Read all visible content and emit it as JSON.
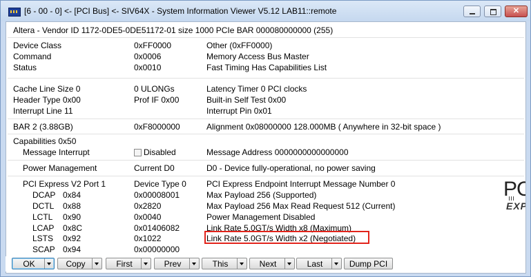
{
  "window": {
    "title": "[6 - 00 - 0] <- [PCI Bus] <- SIV64X - System Information Viewer V5.12 LAB11::remote"
  },
  "header": {
    "device_line": "Altera  - Vendor ID 1172-0DE5-0DE51172-01  size 1000  PCIe BAR 000080000000 (255)"
  },
  "rows": {
    "device_class": [
      "Device Class",
      "0xFF0000",
      "Other (0xFF0000)"
    ],
    "command": [
      "Command",
      "0x0006",
      "Memory Access  Bus Master"
    ],
    "status": [
      "Status",
      "0x0010",
      "Fast Timing  Has Capabilities List"
    ],
    "cache_line": [
      "Cache Line Size 0",
      "0 ULONGs",
      "Latency Timer 0 PCI clocks"
    ],
    "header_type": [
      "Header Type 0x00",
      "Prof IF 0x00",
      "Built-in Self Test 0x00"
    ],
    "interrupt_line": [
      "Interrupt Line 11",
      "",
      "Interrupt Pin  0x01"
    ],
    "bar2": [
      "BAR 2 (3.88GB)",
      "0xF8000000",
      "Alignment 0x08000000       128.000MB  ( Anywhere in 32-bit space )"
    ],
    "capabilities": "Capabilities 0x50",
    "msg_interrupt": [
      "Message Interrupt",
      "Disabled",
      "Message Address 0000000000000000"
    ],
    "power_mgmt": [
      "Power Management",
      "Current D0",
      "D0 - Device fully-operational, no power saving"
    ],
    "pcie_port": [
      "PCI Express V2 Port 1",
      "Device Type 0",
      "PCI Express Endpoint  Interrupt Message Number 0"
    ],
    "dcap": [
      "DCAP",
      "0x84",
      "0x00008001",
      "Max Payload 256 (Supported)"
    ],
    "dctl": [
      "DCTL",
      "0x88",
      "0x2820",
      "Max Payload 256  Max Read Request 512 (Current)"
    ],
    "lctl": [
      "LCTL",
      "0x90",
      "0x0040",
      "Power Management Disabled"
    ],
    "lcap": [
      "LCAP",
      "0x8C",
      "0x01406082",
      "Link Rate 5.0GT/s  Width x8  (Maximum)"
    ],
    "lsts": [
      "LSTS",
      "0x92",
      "0x1022",
      "Link Rate 5.0GT/s  Width x2  (Negotiated)"
    ],
    "scap": [
      "SCAP",
      "0x94",
      "0x00000000",
      ""
    ]
  },
  "logo": {
    "line1": "PC",
    "line2": "EXP"
  },
  "buttons": {
    "ok": "OK",
    "copy": "Copy",
    "first": "First",
    "prev": "Prev",
    "this": "This",
    "next": "Next",
    "last": "Last",
    "dump": "Dump PCI"
  },
  "colors": {
    "highlight_box": "#e2231a"
  }
}
